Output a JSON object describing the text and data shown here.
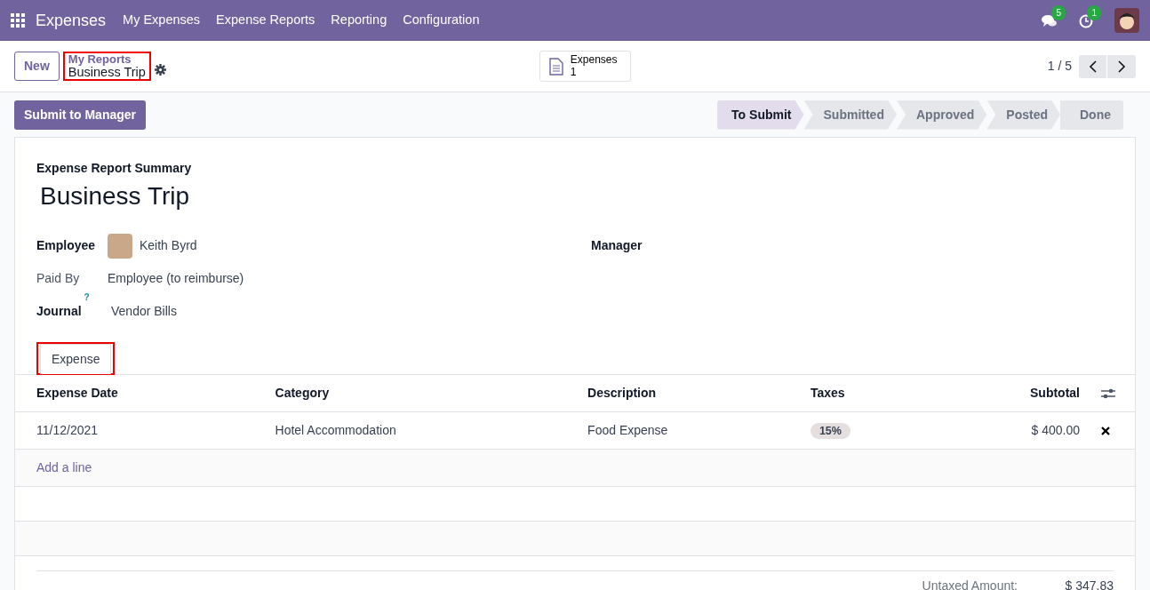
{
  "navbar": {
    "app_name": "Expenses",
    "menu": [
      "My Expenses",
      "Expense Reports",
      "Reporting",
      "Configuration"
    ],
    "messages_count": "5",
    "activities_count": "1"
  },
  "control_panel": {
    "new_button": "New",
    "breadcrumb": {
      "parent": "My Reports",
      "current": "Business Trip",
      "highlighted": true
    },
    "smart_button": {
      "label": "Expenses",
      "count": "1"
    },
    "pager": "1 / 5"
  },
  "action_button": "Submit to Manager",
  "stages": [
    {
      "label": "To Submit",
      "selected": true
    },
    {
      "label": "Submitted",
      "selected": false
    },
    {
      "label": "Approved",
      "selected": false
    },
    {
      "label": "Posted",
      "selected": false
    },
    {
      "label": "Done",
      "selected": false
    }
  ],
  "form": {
    "overline": "Expense Report Summary",
    "title": "Business Trip",
    "left_fields": [
      {
        "label": "Employee",
        "value": "Keith Byrd",
        "kind": "avatar",
        "bold": true
      },
      {
        "label": "Paid By",
        "value": "Employee (to reimburse)",
        "kind": "text",
        "bold": false
      },
      {
        "label": "Journal",
        "value": "Vendor Bills",
        "kind": "help",
        "help": "?",
        "bold": true
      }
    ],
    "right_fields": [
      {
        "label": "Manager",
        "bold": true
      }
    ]
  },
  "tabs": [
    {
      "label": "Expense",
      "selected": true,
      "highlighted": true
    }
  ],
  "lines": {
    "columns": [
      "Expense Date",
      "Category",
      "Description",
      "Taxes",
      "Subtotal"
    ],
    "rows": [
      {
        "date": "11/12/2021",
        "category": "Hotel Accommodation",
        "description": "Food Expense",
        "tax": "15%",
        "subtotal": "$ 400.00"
      }
    ],
    "add_line": "Add a line"
  },
  "totals": [
    {
      "label": "Untaxed Amount:",
      "value": "$ 347.83"
    }
  ]
}
